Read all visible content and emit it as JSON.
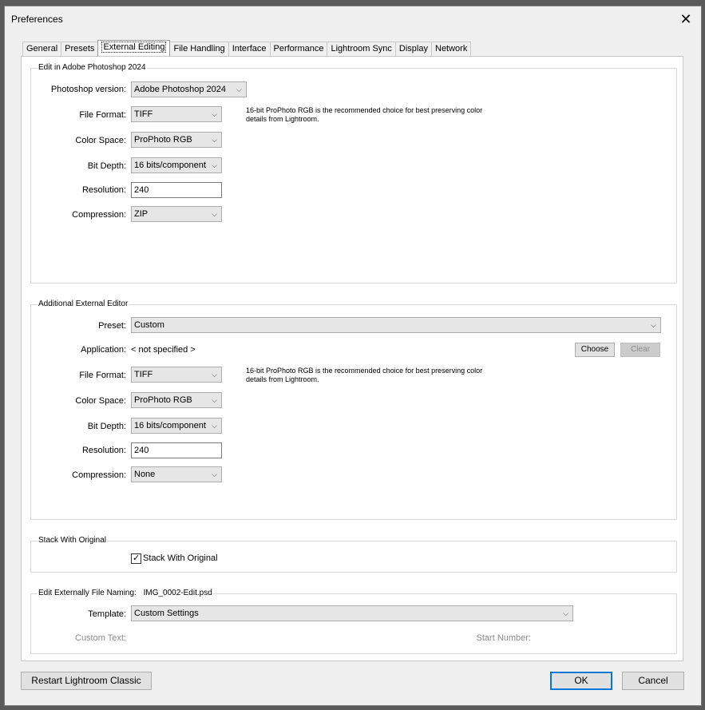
{
  "window": {
    "title": "Preferences",
    "close_glyph": "✕"
  },
  "tabs": [
    {
      "label": "General"
    },
    {
      "label": "Presets"
    },
    {
      "label": "External Editing",
      "active": true
    },
    {
      "label": "File Handling"
    },
    {
      "label": "Interface"
    },
    {
      "label": "Performance"
    },
    {
      "label": "Lightroom Sync"
    },
    {
      "label": "Display"
    },
    {
      "label": "Network"
    }
  ],
  "photoshop": {
    "title": "Edit in Adobe Photoshop 2024",
    "version_label": "Photoshop version:",
    "version_value": "Adobe Photoshop 2024",
    "file_format_label": "File Format:",
    "file_format_value": "TIFF",
    "note": "16-bit ProPhoto RGB is the recommended choice for best preserving color details from Lightroom.",
    "color_space_label": "Color Space:",
    "color_space_value": "ProPhoto RGB",
    "bit_depth_label": "Bit Depth:",
    "bit_depth_value": "16 bits/component",
    "resolution_label": "Resolution:",
    "resolution_value": "240",
    "compression_label": "Compression:",
    "compression_value": "ZIP"
  },
  "additional": {
    "title": "Additional External Editor",
    "preset_label": "Preset:",
    "preset_value": "Custom",
    "application_label": "Application:",
    "application_value": "< not specified >",
    "choose_label": "Choose",
    "clear_label": "Clear",
    "file_format_label": "File Format:",
    "file_format_value": "TIFF",
    "note": "16-bit ProPhoto RGB is the recommended choice for best preserving color details from Lightroom.",
    "color_space_label": "Color Space:",
    "color_space_value": "ProPhoto RGB",
    "bit_depth_label": "Bit Depth:",
    "bit_depth_value": "16 bits/component",
    "resolution_label": "Resolution:",
    "resolution_value": "240",
    "compression_label": "Compression:",
    "compression_value": "None"
  },
  "stack": {
    "title": "Stack With Original",
    "checkbox_label": "Stack With Original",
    "checked": true
  },
  "naming": {
    "title": "Edit Externally File Naming:",
    "example": "IMG_0002-Edit.psd",
    "template_label": "Template:",
    "template_value": "Custom Settings",
    "custom_text_label": "Custom Text:",
    "start_number_label": "Start Number:"
  },
  "footer": {
    "restart_label": "Restart Lightroom Classic",
    "ok_label": "OK",
    "cancel_label": "Cancel"
  },
  "icons": {
    "dropdown": "chevron-down-icon",
    "close": "close-icon",
    "check": "checkmark-icon"
  },
  "colors": {
    "default_button_border": "#0078d7"
  }
}
